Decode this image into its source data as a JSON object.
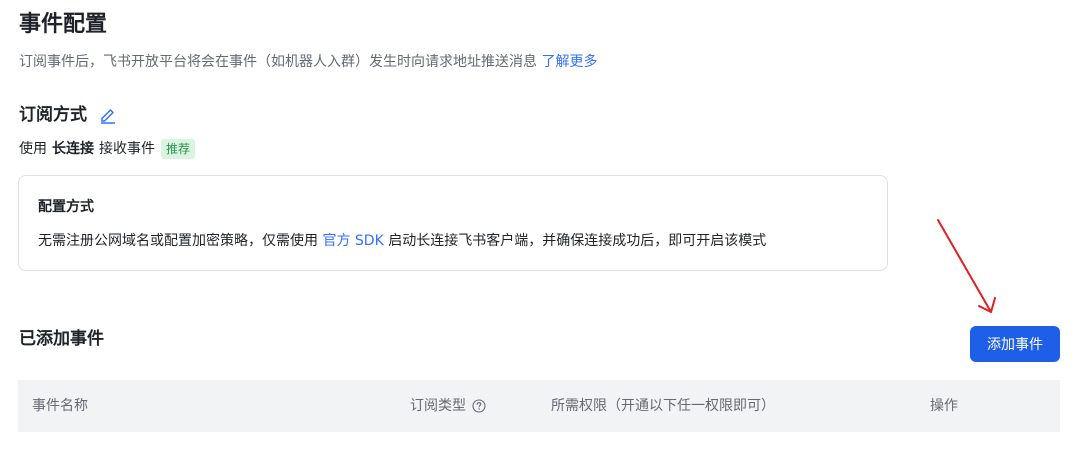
{
  "header": {
    "title": "事件配置",
    "description": "订阅事件后，飞书开放平台将会在事件（如机器人入群）发生时向请求地址推送消息 ",
    "learn_more_link": "了解更多"
  },
  "subscription": {
    "title": "订阅方式",
    "edit_icon": "pencil-icon",
    "prefix": "使用",
    "mode": "长连接",
    "suffix": "接收事件",
    "badge": "推荐"
  },
  "config_box": {
    "title": "配置方式",
    "text_before": "无需注册公网域名或配置加密策略，仅需使用 ",
    "sdk_link": "官方 SDK",
    "text_after": " 启动长连接飞书客户端，并确保连接成功后，即可开启该模式"
  },
  "events": {
    "title": "已添加事件",
    "add_button": "添加事件",
    "columns": {
      "name": "事件名称",
      "type": "订阅类型",
      "permission": "所需权限（开通以下任一权限即可）",
      "operations": "操作"
    },
    "help_icon": "question-circle-icon"
  },
  "colors": {
    "accent": "#1f5fe8",
    "link": "#3370ff",
    "badge_bg": "#d9f5e0",
    "badge_text": "#2f8f4e",
    "annotation_arrow": "#e02020"
  }
}
